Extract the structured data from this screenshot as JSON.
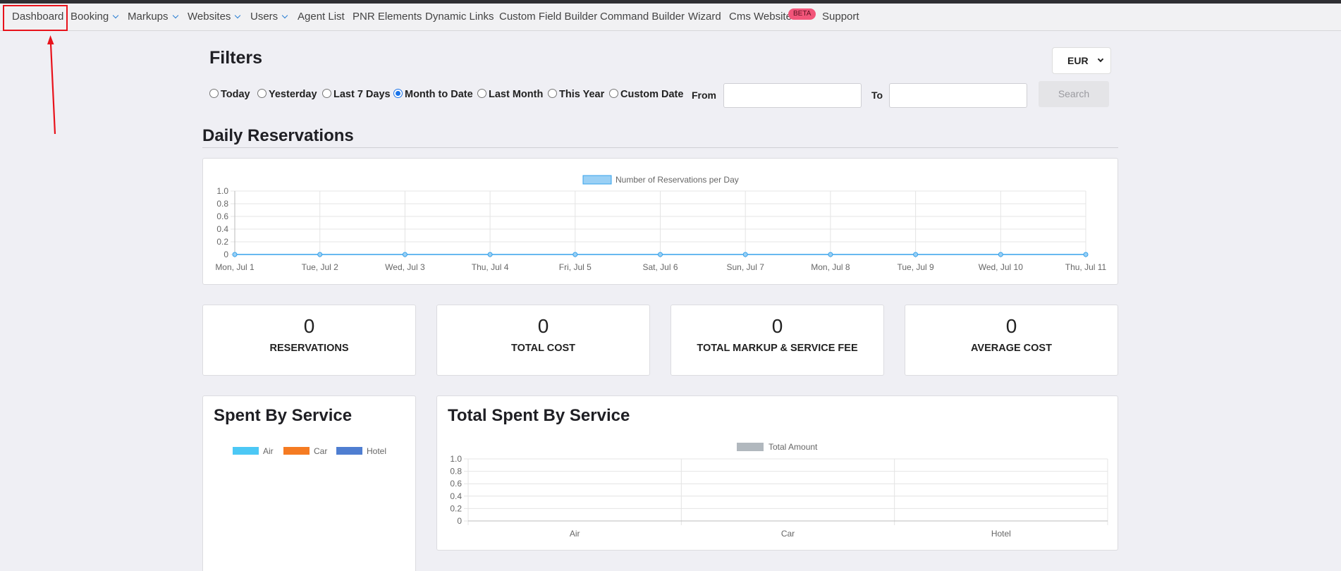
{
  "nav": {
    "items": [
      {
        "label": "Dashboard",
        "dropdown": false
      },
      {
        "label": "Booking",
        "dropdown": true
      },
      {
        "label": "Markups",
        "dropdown": true
      },
      {
        "label": "Websites",
        "dropdown": true
      },
      {
        "label": "Users",
        "dropdown": true
      },
      {
        "label": "Agent List",
        "dropdown": false
      },
      {
        "label": "PNR Elements",
        "dropdown": false
      },
      {
        "label": "Dynamic Links",
        "dropdown": false
      },
      {
        "label": "Custom Field Builder",
        "dropdown": false
      },
      {
        "label": "Command Builder",
        "dropdown": false
      },
      {
        "label": "Wizard",
        "dropdown": false
      },
      {
        "label": "Cms Website",
        "dropdown": false,
        "badge": "BETA"
      },
      {
        "label": "Support",
        "dropdown": false
      }
    ],
    "active": "Dashboard"
  },
  "filters": {
    "title": "Filters",
    "currency": "EUR",
    "ranges": [
      {
        "label": "Today",
        "checked": false
      },
      {
        "label": "Yesterday",
        "checked": false
      },
      {
        "label": "Last 7 Days",
        "checked": false
      },
      {
        "label": "Month to Date",
        "checked": true
      },
      {
        "label": "Last Month",
        "checked": false
      },
      {
        "label": "This Year",
        "checked": false
      },
      {
        "label": "Custom Date",
        "checked": false
      }
    ],
    "from_label": "From",
    "to_label": "To",
    "from_value": "",
    "to_value": "",
    "search_label": "Search"
  },
  "daily": {
    "title": "Daily Reservations"
  },
  "stats": [
    {
      "value": "0",
      "label": "RESERVATIONS"
    },
    {
      "value": "0",
      "label": "TOTAL COST"
    },
    {
      "value": "0",
      "label": "TOTAL MARKUP & SERVICE FEE"
    },
    {
      "value": "0",
      "label": "AVERAGE COST"
    }
  ],
  "spent_by_service": {
    "title": "Spent By Service"
  },
  "total_spent": {
    "title": "Total Spent By Service"
  },
  "colors": {
    "line_series": "#36a2eb",
    "line_fill": "#9ad0f5",
    "air": "#4cc8f5",
    "car": "#f57b22",
    "hotel": "#4f7ed1",
    "total_amount": "#b1b8be",
    "annotation": "#e8121b"
  },
  "chart_data": [
    {
      "type": "line",
      "x": [
        "Mon, Jul 1",
        "Tue, Jul 2",
        "Wed, Jul 3",
        "Thu, Jul 4",
        "Fri, Jul 5",
        "Sat, Jul 6",
        "Sun, Jul 7",
        "Mon, Jul 8",
        "Tue, Jul 9",
        "Wed, Jul 10",
        "Thu, Jul 11"
      ],
      "series": [
        {
          "name": "Number of Reservations per Day",
          "values": [
            0,
            0,
            0,
            0,
            0,
            0,
            0,
            0,
            0,
            0,
            0
          ]
        }
      ],
      "yticks": [
        "1.0",
        "0.8",
        "0.6",
        "0.4",
        "0.2",
        "0"
      ],
      "ylim": [
        0,
        1
      ],
      "grid": true,
      "legend": "top-center"
    },
    {
      "type": "pie",
      "categories": [
        "Air",
        "Car",
        "Hotel"
      ],
      "values": [
        0,
        0,
        0
      ],
      "legend": "top-center"
    },
    {
      "type": "bar",
      "categories": [
        "Air",
        "Car",
        "Hotel"
      ],
      "series": [
        {
          "name": "Total Amount",
          "values": [
            0,
            0,
            0
          ]
        }
      ],
      "yticks": [
        "1.0",
        "0.8",
        "0.6",
        "0.4",
        "0.2",
        "0"
      ],
      "ylim": [
        0,
        1
      ],
      "grid": true,
      "legend": "top-center"
    }
  ]
}
